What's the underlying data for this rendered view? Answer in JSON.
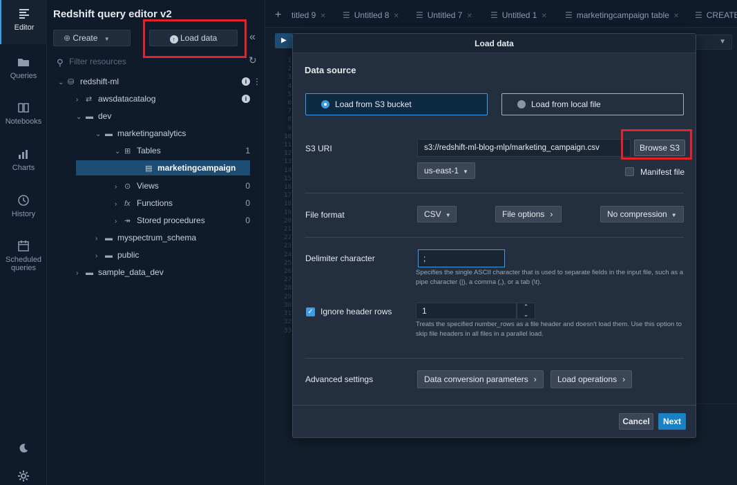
{
  "rail": {
    "items": [
      {
        "label": "Editor",
        "icon": "editor-icon"
      },
      {
        "label": "Queries",
        "icon": "folder-icon"
      },
      {
        "label": "Notebooks",
        "icon": "notebook-icon"
      },
      {
        "label": "Charts",
        "icon": "charts-icon"
      },
      {
        "label": "History",
        "icon": "history-icon"
      },
      {
        "label": "Scheduled",
        "label2": "queries",
        "icon": "calendar-icon"
      }
    ]
  },
  "panel": {
    "title": "Redshift query editor v2",
    "create_label": "Create",
    "load_label": "Load data",
    "filter_placeholder": "Filter resources"
  },
  "tree": [
    {
      "label": "redshift-ml",
      "icon": "cluster-icon"
    },
    {
      "label": "awsdatacatalog",
      "icon": "catalog-icon"
    },
    {
      "label": "dev",
      "icon": "folder-icon"
    },
    {
      "label": "marketinganalytics",
      "icon": "folder-icon"
    },
    {
      "label": "Tables",
      "icon": "tables-icon",
      "count": "1"
    },
    {
      "label": "marketingcampaign",
      "icon": "table-icon"
    },
    {
      "label": "Views",
      "icon": "eye-icon",
      "count": "0"
    },
    {
      "label": "Functions",
      "icon": "function-icon",
      "count": "0"
    },
    {
      "label": "Stored procedures",
      "icon": "procedure-icon",
      "count": "0"
    },
    {
      "label": "myspectrum_schema",
      "icon": "folder-icon"
    },
    {
      "label": "public",
      "icon": "folder-icon"
    },
    {
      "label": "sample_data_dev",
      "icon": "folder-icon"
    }
  ],
  "tabs": [
    "titled 9",
    "Untitled 8",
    "Untitled 7",
    "Untitled 1",
    "marketingcampaign table",
    "CREATE"
  ],
  "line_numbers": "1\n2\n3\n4\n5\n6\n7\n8\n9\n10\n11\n12\n13\n14\n15\n16\n17\n18\n19\n20\n21\n22\n23\n24\n25\n26\n27\n28\n29\n30\n31\n32\n33",
  "modal": {
    "title": "Load data",
    "data_source_title": "Data source",
    "option_s3": "Load from S3 bucket",
    "option_local": "Load from local file",
    "s3_uri_label": "S3 URI",
    "s3_uri_value": "s3://redshift-ml-blog-mlp/marketing_campaign.csv",
    "browse_label": "Browse S3",
    "region": "us-east-1",
    "manifest_label": "Manifest file",
    "file_format_label": "File format",
    "file_format_value": "CSV",
    "file_options_label": "File options",
    "compression_value": "No compression",
    "delimiter_label": "Delimiter character",
    "delimiter_value": ";",
    "delimiter_hint": "Specifies the single ASCII character that is used to separate fields in the input file, such as a pipe character (|), a comma (,), or a tab (\\t).",
    "ignore_header_label": "Ignore header rows",
    "ignore_header_value": "1",
    "ignore_header_hint": "Treats the specified number_rows as a file header and doesn't load them. Use this option to skip file headers in all files in a parallel load.",
    "advanced_label": "Advanced settings",
    "data_conversion_label": "Data conversion parameters",
    "load_operations_label": "Load operations",
    "cancel_label": "Cancel",
    "next_label": "Next"
  },
  "colors": {
    "accent": "#3d9ce6",
    "primary_button": "#1a81c5",
    "annotation": "#e3232a",
    "background": "#0f1b2a",
    "modal": "#232f3e"
  }
}
